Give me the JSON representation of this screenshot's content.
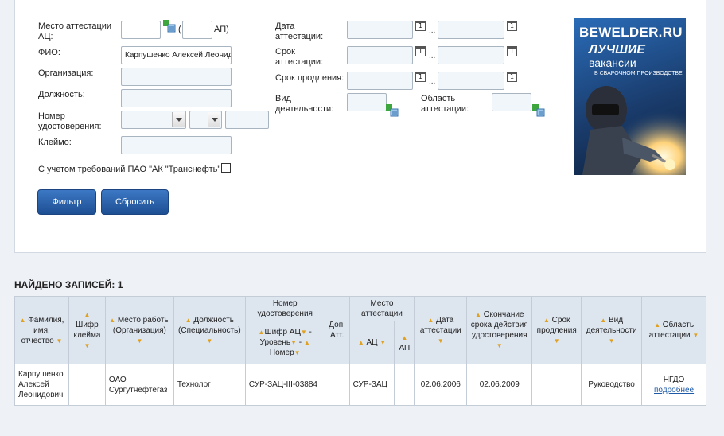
{
  "filter": {
    "ac_label": "Место аттестации АЦ:",
    "ac_sep_open": "(",
    "ap_label": "АП)",
    "fio_label": "ФИО:",
    "fio_value": "Карпушенко Алексей Леонидович",
    "org_label": "Организация:",
    "position_label": "Должность:",
    "cert_label": "Номер удостоверения:",
    "stamp_label": "Клеймо:",
    "transneft_label": "С учетом требований ПАО \"АК \"Транснефть\":",
    "date_label": "Дата аттестации:",
    "term_label": "Срок аттестации:",
    "ext_label": "Срок продления:",
    "activity_label": "Вид деятельности:",
    "area_label": "Область аттестации:",
    "range_sep": "...",
    "cal_glyph": "1",
    "filter_button": "Фильтр",
    "reset_button": "Сбросить"
  },
  "ad": {
    "line1": "BEWELDER.RU",
    "line2": "ЛУЧШИЕ",
    "line3": "вакансии",
    "line4": "В СВАРОЧНОМ ПРОИЗВОДСТВЕ"
  },
  "results": {
    "found": "НАЙДЕНО ЗАПИСЕЙ: 1",
    "headers": {
      "fio": "Фамилия, имя, отчество",
      "stamp": "Шифр клейма",
      "workplace": "Место работы (Организация)",
      "position": "Должность (Специальность)",
      "cert_number": "Номер удостоверения",
      "cert_sub_a": "Шифр АЦ",
      "cert_sub_b": "Уровень",
      "cert_sub_c": "Номер",
      "extra": "Доп. Атт.",
      "place": "Место аттестации",
      "place_ac": "АЦ",
      "place_ap": "АП",
      "date": "Дата аттестации",
      "end": "Окончание срока действия удостоверения",
      "ext": "Срок продления",
      "activity": "Вид деятельности",
      "area": "Область аттестации"
    },
    "rows": [
      {
        "fio": "Карпушенко Алексей Леонидович",
        "stamp": "",
        "workplace": "ОАО Сургутнефтегаз",
        "position": "Технолог",
        "cert_number": "СУР-ЗАЦ-III-03884",
        "extra": "",
        "ac": "СУР-ЗАЦ",
        "ap": "",
        "date": "02.06.2006",
        "end": "02.06.2009",
        "ext": "",
        "activity": "Руководство",
        "area": "НГДО",
        "more": "подробнее"
      }
    ]
  }
}
